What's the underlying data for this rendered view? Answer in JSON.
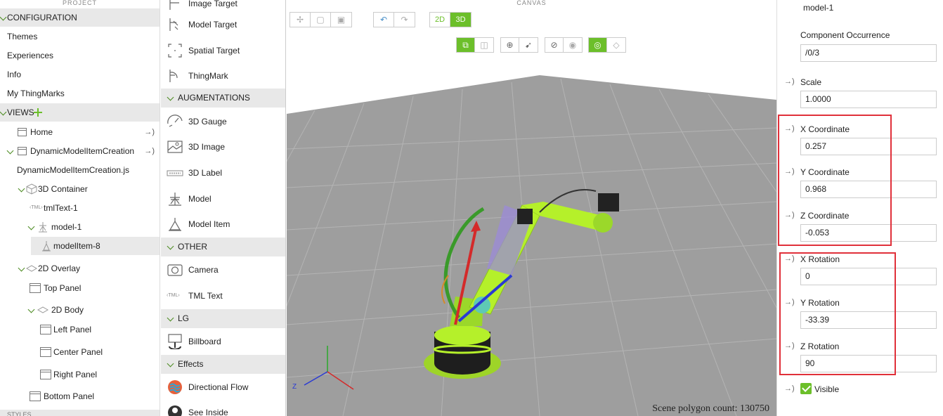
{
  "project": {
    "header": "PROJECT",
    "configuration": "CONFIGURATION",
    "config_items": [
      "Themes",
      "Experiences",
      "Info",
      "My ThingMarks"
    ],
    "views": "VIEWS",
    "tree": {
      "home": "Home",
      "dynamic_view": "DynamicModelItemCreation",
      "dynamic_js": "DynamicModelItemCreation.js",
      "container_3d": "3D Container",
      "tml_text": "tmlText-1",
      "model": "model-1",
      "model_item": "modelItem-8",
      "overlay_2d": "2D Overlay",
      "top_panel": "Top Panel",
      "body_2d": "2D Body",
      "left_panel": "Left Panel",
      "center_panel": "Center Panel",
      "right_panel": "Right Panel",
      "bottom_panel": "Bottom Panel"
    },
    "styles": "STYLES"
  },
  "palette": {
    "targets": [
      "Image Target",
      "Model Target",
      "Spatial Target",
      "ThingMark"
    ],
    "augmentations_header": "AUGMENTATIONS",
    "augmentations": [
      "3D Gauge",
      "3D Image",
      "3D Label",
      "Model",
      "Model Item"
    ],
    "other_header": "OTHER",
    "other": [
      "Camera",
      "TML Text"
    ],
    "lg_header": "LG",
    "lg": [
      "Billboard"
    ],
    "effects_header": "Effects",
    "effects": [
      "Directional Flow",
      "See Inside"
    ]
  },
  "canvas": {
    "title": "CANVAS",
    "mode_2d": "2D",
    "mode_3d": "3D",
    "active_mode": "3D",
    "polygon_count": "Scene polygon count: 130750",
    "axis_z": "Z"
  },
  "properties": {
    "model_name": "model-1",
    "component_occurrence": {
      "label": "Component Occurrence",
      "value": "/0/3"
    },
    "scale": {
      "label": "Scale",
      "value": "1.0000"
    },
    "x_coordinate": {
      "label": "X Coordinate",
      "value": "0.257"
    },
    "y_coordinate": {
      "label": "Y Coordinate",
      "value": "0.968"
    },
    "z_coordinate": {
      "label": "Z Coordinate",
      "value": "-0.053"
    },
    "x_rotation": {
      "label": "X Rotation",
      "value": "0"
    },
    "y_rotation": {
      "label": "Y Rotation",
      "value": "-33.39"
    },
    "z_rotation": {
      "label": "Z Rotation",
      "value": "90"
    },
    "visible": {
      "label": "Visible",
      "checked": true
    },
    "binding_indicator": "→)"
  },
  "colors": {
    "accent_green": "#6cbf2a",
    "highlight_red": "#e0303a",
    "section_gray": "#e8e8e8",
    "floor_gray": "#9e9e9e",
    "robot_green": "#b5f02a"
  }
}
